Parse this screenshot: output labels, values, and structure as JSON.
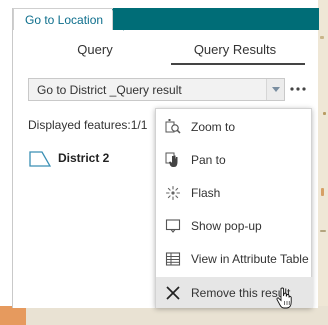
{
  "panel": {
    "title": "Go to Location",
    "tabs": [
      {
        "label": "Query"
      },
      {
        "label": "Query Results"
      }
    ],
    "select": {
      "value": "Go to District _Query result"
    },
    "displayed_features": "Displayed features:1/1",
    "result": {
      "label": "District 2"
    }
  },
  "menu": {
    "items": [
      {
        "label": "Zoom to",
        "icon": "zoom-to-icon"
      },
      {
        "label": "Pan to",
        "icon": "pan-to-icon"
      },
      {
        "label": "Flash",
        "icon": "flash-icon"
      },
      {
        "label": "Show pop-up",
        "icon": "popup-icon"
      },
      {
        "label": "View in Attribute Table",
        "icon": "table-icon"
      },
      {
        "label": "Remove this result",
        "icon": "close-icon"
      }
    ]
  },
  "colors": {
    "header": "#006d77",
    "title_text": "#0d6e8c",
    "menu_hover": "#e6e6e6"
  }
}
